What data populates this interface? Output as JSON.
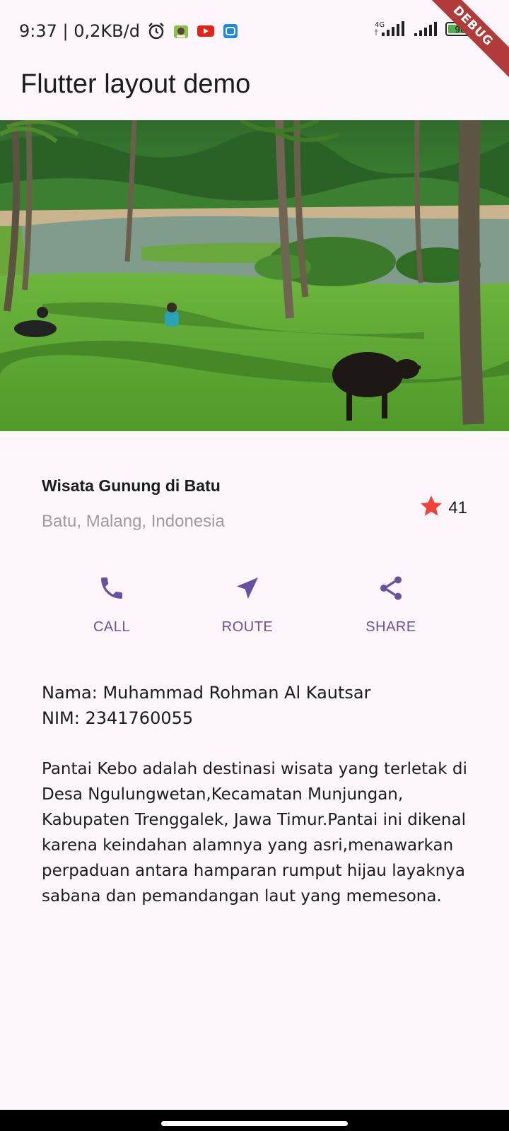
{
  "status_bar": {
    "time_speed": "9:37 | 0,2KB/d",
    "network": "4G",
    "battery": "96",
    "icons": [
      "alarm-icon",
      "app-notification-icon",
      "youtube-icon",
      "messenger-icon",
      "signal-icon",
      "wifi-signal-icon",
      "battery-icon",
      "charging-icon"
    ]
  },
  "debug_banner": "DEBUG",
  "app_bar": {
    "title": "Flutter layout demo"
  },
  "hero": {
    "icon": "beach-landscape-photo"
  },
  "title_section": {
    "name": "Wisata Gunung di Batu",
    "location": "Batu, Malang, Indonesia",
    "rating_count": "41",
    "star_color": "#f44336"
  },
  "actions": [
    {
      "label": "CALL",
      "icon": "phone-icon"
    },
    {
      "label": "ROUTE",
      "icon": "navigation-icon"
    },
    {
      "label": "SHARE",
      "icon": "share-icon"
    }
  ],
  "accent_color": "#6750a4",
  "description": {
    "name_line": "Nama: Muhammad Rohman Al Kautsar",
    "nim_line": "NIM: 2341760055",
    "body": "Pantai Kebo adalah destinasi wisata yang terletak di Desa Ngulungwetan,Kecamatan Munjungan, Kabupaten Trenggalek, Jawa Timur.Pantai ini dikenal karena keindahan alamnya yang asri,menawarkan perpaduan antara hamparan rumput hijau layaknya sabana dan pemandangan laut yang memesona."
  }
}
